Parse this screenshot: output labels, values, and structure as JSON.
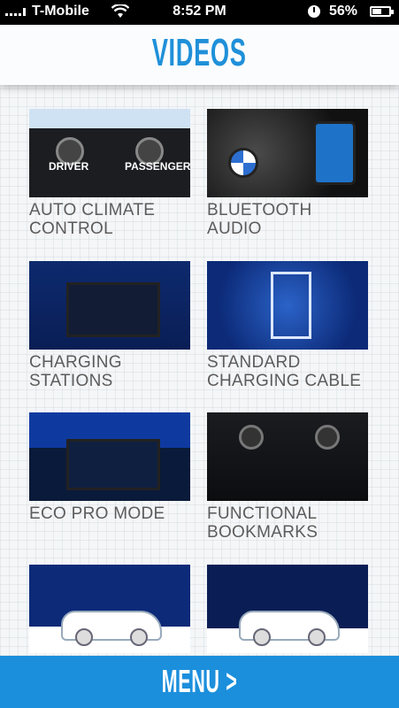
{
  "status_bar": {
    "carrier": "T-Mobile",
    "time": "8:52 PM",
    "battery": "56%",
    "battery_level": 0.56
  },
  "header": {
    "title": "VIDEOS"
  },
  "videos": [
    {
      "label": "AUTO CLIMATE CONTROL",
      "thumb": "climate-control"
    },
    {
      "label": "BLUETOOTH AUDIO",
      "thumb": "bluetooth"
    },
    {
      "label": "CHARGING STATIONS",
      "thumb": "navigation-map"
    },
    {
      "label": "STANDARD CHARGING CABLE",
      "thumb": "charging-cable"
    },
    {
      "label": "ECO PRO MODE",
      "thumb": "eco-pro-screen"
    },
    {
      "label": "FUNCTIONAL BOOKMARKS",
      "thumb": "radio-buttons"
    },
    {
      "label": "",
      "thumb": "car"
    },
    {
      "label": "",
      "thumb": "car-winter"
    }
  ],
  "menu": {
    "label": "MENU >"
  },
  "colors": {
    "accent": "#1c8fdc",
    "title": "#1f90d9",
    "label": "#5c5c5c"
  }
}
